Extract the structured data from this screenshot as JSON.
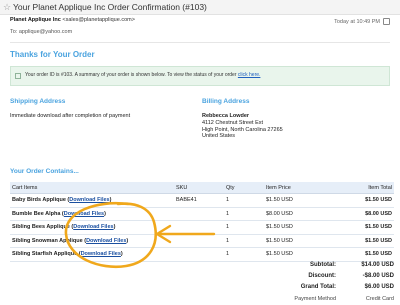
{
  "email": {
    "subject": "Your Planet Applique Inc Order Confirmation (#103)",
    "from_name": "Planet Applique Inc",
    "from_address": "<sales@planetapplique.com>",
    "to": "To: applique@yahoo.com",
    "time": "Today at 10:49 PM"
  },
  "body": {
    "thanks_title": "Thanks for Your Order",
    "info_text": "Your order ID is #103. A summary of your order is shown below. To view the status of your order ",
    "info_link": "click here."
  },
  "shipping": {
    "title": "Shipping Address",
    "text": "Immediate download after completion of payment"
  },
  "billing": {
    "title": "Billing Address",
    "name": "Rebbecca Lowder",
    "street": "4112 Chestnut Street Ext",
    "city": "High Point, North Carolina 27265",
    "country": "United States"
  },
  "cart": {
    "title": "Your Order Contains...",
    "headers": {
      "item": "Cart Items",
      "sku": "SKU",
      "qty": "Qty",
      "price": "Item Price",
      "total": "Item Total"
    },
    "rows": [
      {
        "name": "Baby Birds Applique",
        "link": "Download Files",
        "sku": "BABE41",
        "qty": "1",
        "price": "$1.50 USD",
        "total": "$1.50 USD"
      },
      {
        "name": "Bumble Bee Alpha",
        "link": "Download Files",
        "sku": "",
        "qty": "1",
        "price": "$8.00 USD",
        "total": "$8.00 USD"
      },
      {
        "name": "Sibling Bees Applique",
        "link": "Download Files",
        "sku": "",
        "qty": "1",
        "price": "$1.50 USD",
        "total": "$1.50 USD"
      },
      {
        "name": "Sibling Snowman Applique",
        "link": "Download Files",
        "sku": "",
        "qty": "1",
        "price": "$1.50 USD",
        "total": "$1.50 USD"
      },
      {
        "name": "Sibling Starfish Applique",
        "link": "Download Files",
        "sku": "",
        "qty": "1",
        "price": "$1.50 USD",
        "total": "$1.50 USD"
      }
    ]
  },
  "summary": {
    "subtotal_label": "Subtotal:",
    "subtotal": "$14.00 USD",
    "discount_label": "Discount:",
    "discount": "-$8.00 USD",
    "grand_label": "Grand Total:",
    "grand": "$6.00 USD",
    "payment_label": "Payment Method",
    "payment": "Credit Card"
  },
  "colors": {
    "heading": "#4aa3df",
    "annotation": "#f0a81c",
    "link": "#1a4fa0"
  }
}
